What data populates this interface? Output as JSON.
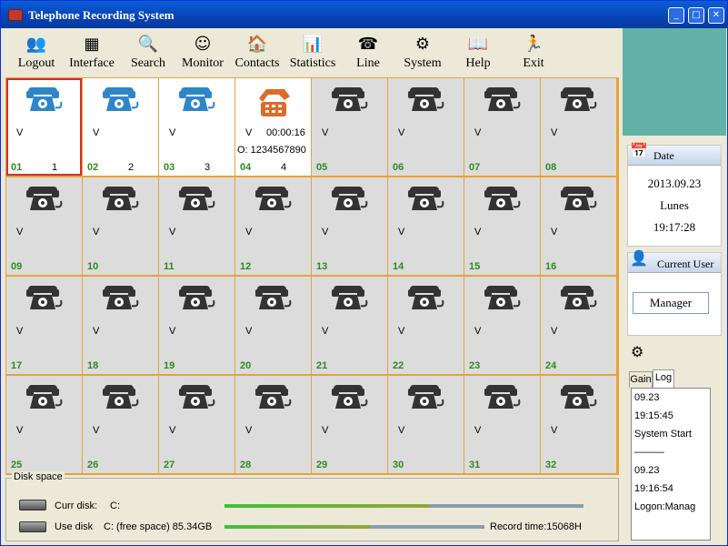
{
  "window": {
    "title": "Telephone Recording System",
    "controls": [
      "_",
      "□",
      "✕"
    ]
  },
  "toolbar": [
    {
      "label": "Logout",
      "icon": "users-icon",
      "glyph": "👥"
    },
    {
      "label": "Interface",
      "icon": "interface-icon",
      "glyph": "▦"
    },
    {
      "label": "Search",
      "icon": "search-icon",
      "glyph": "🔍"
    },
    {
      "label": "Monitor",
      "icon": "monitor-icon",
      "glyph": "☺"
    },
    {
      "label": "Contacts",
      "icon": "contacts-icon",
      "glyph": "🏠"
    },
    {
      "label": "Statistics",
      "icon": "statistics-icon",
      "glyph": "📊"
    },
    {
      "label": "Line",
      "icon": "line-icon",
      "glyph": "☎"
    },
    {
      "label": "System",
      "icon": "system-icon",
      "glyph": "⚙"
    },
    {
      "label": "Help",
      "icon": "help-icon",
      "glyph": "📖"
    },
    {
      "label": "Exit",
      "icon": "exit-icon",
      "glyph": "🏃"
    }
  ],
  "lines": [
    {
      "num": "01",
      "status": "idle",
      "v": "V",
      "index": "1",
      "duration": "",
      "caller": ""
    },
    {
      "num": "02",
      "status": "idle",
      "v": "V",
      "index": "2",
      "duration": "",
      "caller": ""
    },
    {
      "num": "03",
      "status": "idle",
      "v": "V",
      "index": "3",
      "duration": "",
      "caller": ""
    },
    {
      "num": "04",
      "status": "active",
      "v": "V",
      "index": "4",
      "duration": "00:00:16",
      "caller": "O: 1234567890"
    },
    {
      "num": "05",
      "status": "offline",
      "v": "V",
      "index": "",
      "duration": "",
      "caller": ""
    },
    {
      "num": "06",
      "status": "offline",
      "v": "V",
      "index": "",
      "duration": "",
      "caller": ""
    },
    {
      "num": "07",
      "status": "offline",
      "v": "V",
      "index": "",
      "duration": "",
      "caller": ""
    },
    {
      "num": "08",
      "status": "offline",
      "v": "V",
      "index": "",
      "duration": "",
      "caller": ""
    },
    {
      "num": "09",
      "status": "offline",
      "v": "V",
      "index": "",
      "duration": "",
      "caller": ""
    },
    {
      "num": "10",
      "status": "offline",
      "v": "V",
      "index": "",
      "duration": "",
      "caller": ""
    },
    {
      "num": "11",
      "status": "offline",
      "v": "V",
      "index": "",
      "duration": "",
      "caller": ""
    },
    {
      "num": "12",
      "status": "offline",
      "v": "V",
      "index": "",
      "duration": "",
      "caller": ""
    },
    {
      "num": "13",
      "status": "offline",
      "v": "V",
      "index": "",
      "duration": "",
      "caller": ""
    },
    {
      "num": "14",
      "status": "offline",
      "v": "V",
      "index": "",
      "duration": "",
      "caller": ""
    },
    {
      "num": "15",
      "status": "offline",
      "v": "V",
      "index": "",
      "duration": "",
      "caller": ""
    },
    {
      "num": "16",
      "status": "offline",
      "v": "V",
      "index": "",
      "duration": "",
      "caller": ""
    },
    {
      "num": "17",
      "status": "offline",
      "v": "V",
      "index": "",
      "duration": "",
      "caller": ""
    },
    {
      "num": "18",
      "status": "offline",
      "v": "V",
      "index": "",
      "duration": "",
      "caller": ""
    },
    {
      "num": "19",
      "status": "offline",
      "v": "V",
      "index": "",
      "duration": "",
      "caller": ""
    },
    {
      "num": "20",
      "status": "offline",
      "v": "V",
      "index": "",
      "duration": "",
      "caller": ""
    },
    {
      "num": "21",
      "status": "offline",
      "v": "V",
      "index": "",
      "duration": "",
      "caller": ""
    },
    {
      "num": "22",
      "status": "offline",
      "v": "V",
      "index": "",
      "duration": "",
      "caller": ""
    },
    {
      "num": "23",
      "status": "offline",
      "v": "V",
      "index": "",
      "duration": "",
      "caller": ""
    },
    {
      "num": "24",
      "status": "offline",
      "v": "V",
      "index": "",
      "duration": "",
      "caller": ""
    },
    {
      "num": "25",
      "status": "offline",
      "v": "V",
      "index": "",
      "duration": "",
      "caller": ""
    },
    {
      "num": "26",
      "status": "offline",
      "v": "V",
      "index": "",
      "duration": "",
      "caller": ""
    },
    {
      "num": "27",
      "status": "offline",
      "v": "V",
      "index": "",
      "duration": "",
      "caller": ""
    },
    {
      "num": "28",
      "status": "offline",
      "v": "V",
      "index": "",
      "duration": "",
      "caller": ""
    },
    {
      "num": "29",
      "status": "offline",
      "v": "V",
      "index": "",
      "duration": "",
      "caller": ""
    },
    {
      "num": "30",
      "status": "offline",
      "v": "V",
      "index": "",
      "duration": "",
      "caller": ""
    },
    {
      "num": "31",
      "status": "offline",
      "v": "V",
      "index": "",
      "duration": "",
      "caller": ""
    },
    {
      "num": "32",
      "status": "offline",
      "v": "V",
      "index": "",
      "duration": "",
      "caller": ""
    }
  ],
  "colors": {
    "idle_phone": "#2e86c8",
    "active_phone": "#e06a2a",
    "offline_phone": "#333333",
    "grid_border": "#e6a33a",
    "line_number": "#2d8a20"
  },
  "date_panel": {
    "title": "Date",
    "date": "2013.09.23",
    "day": "Lunes",
    "time": "19:17:28"
  },
  "user_panel": {
    "title": "Current User",
    "user": "Manager"
  },
  "log_panel": {
    "tabs": [
      "Gain",
      "Log"
    ],
    "active_tab": "Log",
    "entries": [
      "09.23",
      "19:15:45",
      "System Start",
      "———",
      "09.23",
      "19:16:54",
      "Logon:Manag"
    ]
  },
  "disk": {
    "title": "Disk space",
    "curr_label": "Curr disk:",
    "curr_value": "C:",
    "curr_used": 0.57,
    "use_label": "Use disk",
    "use_value": "C: (free space)  85.34GB",
    "use_used": 0.56,
    "record_time": "Record time:15068H"
  }
}
